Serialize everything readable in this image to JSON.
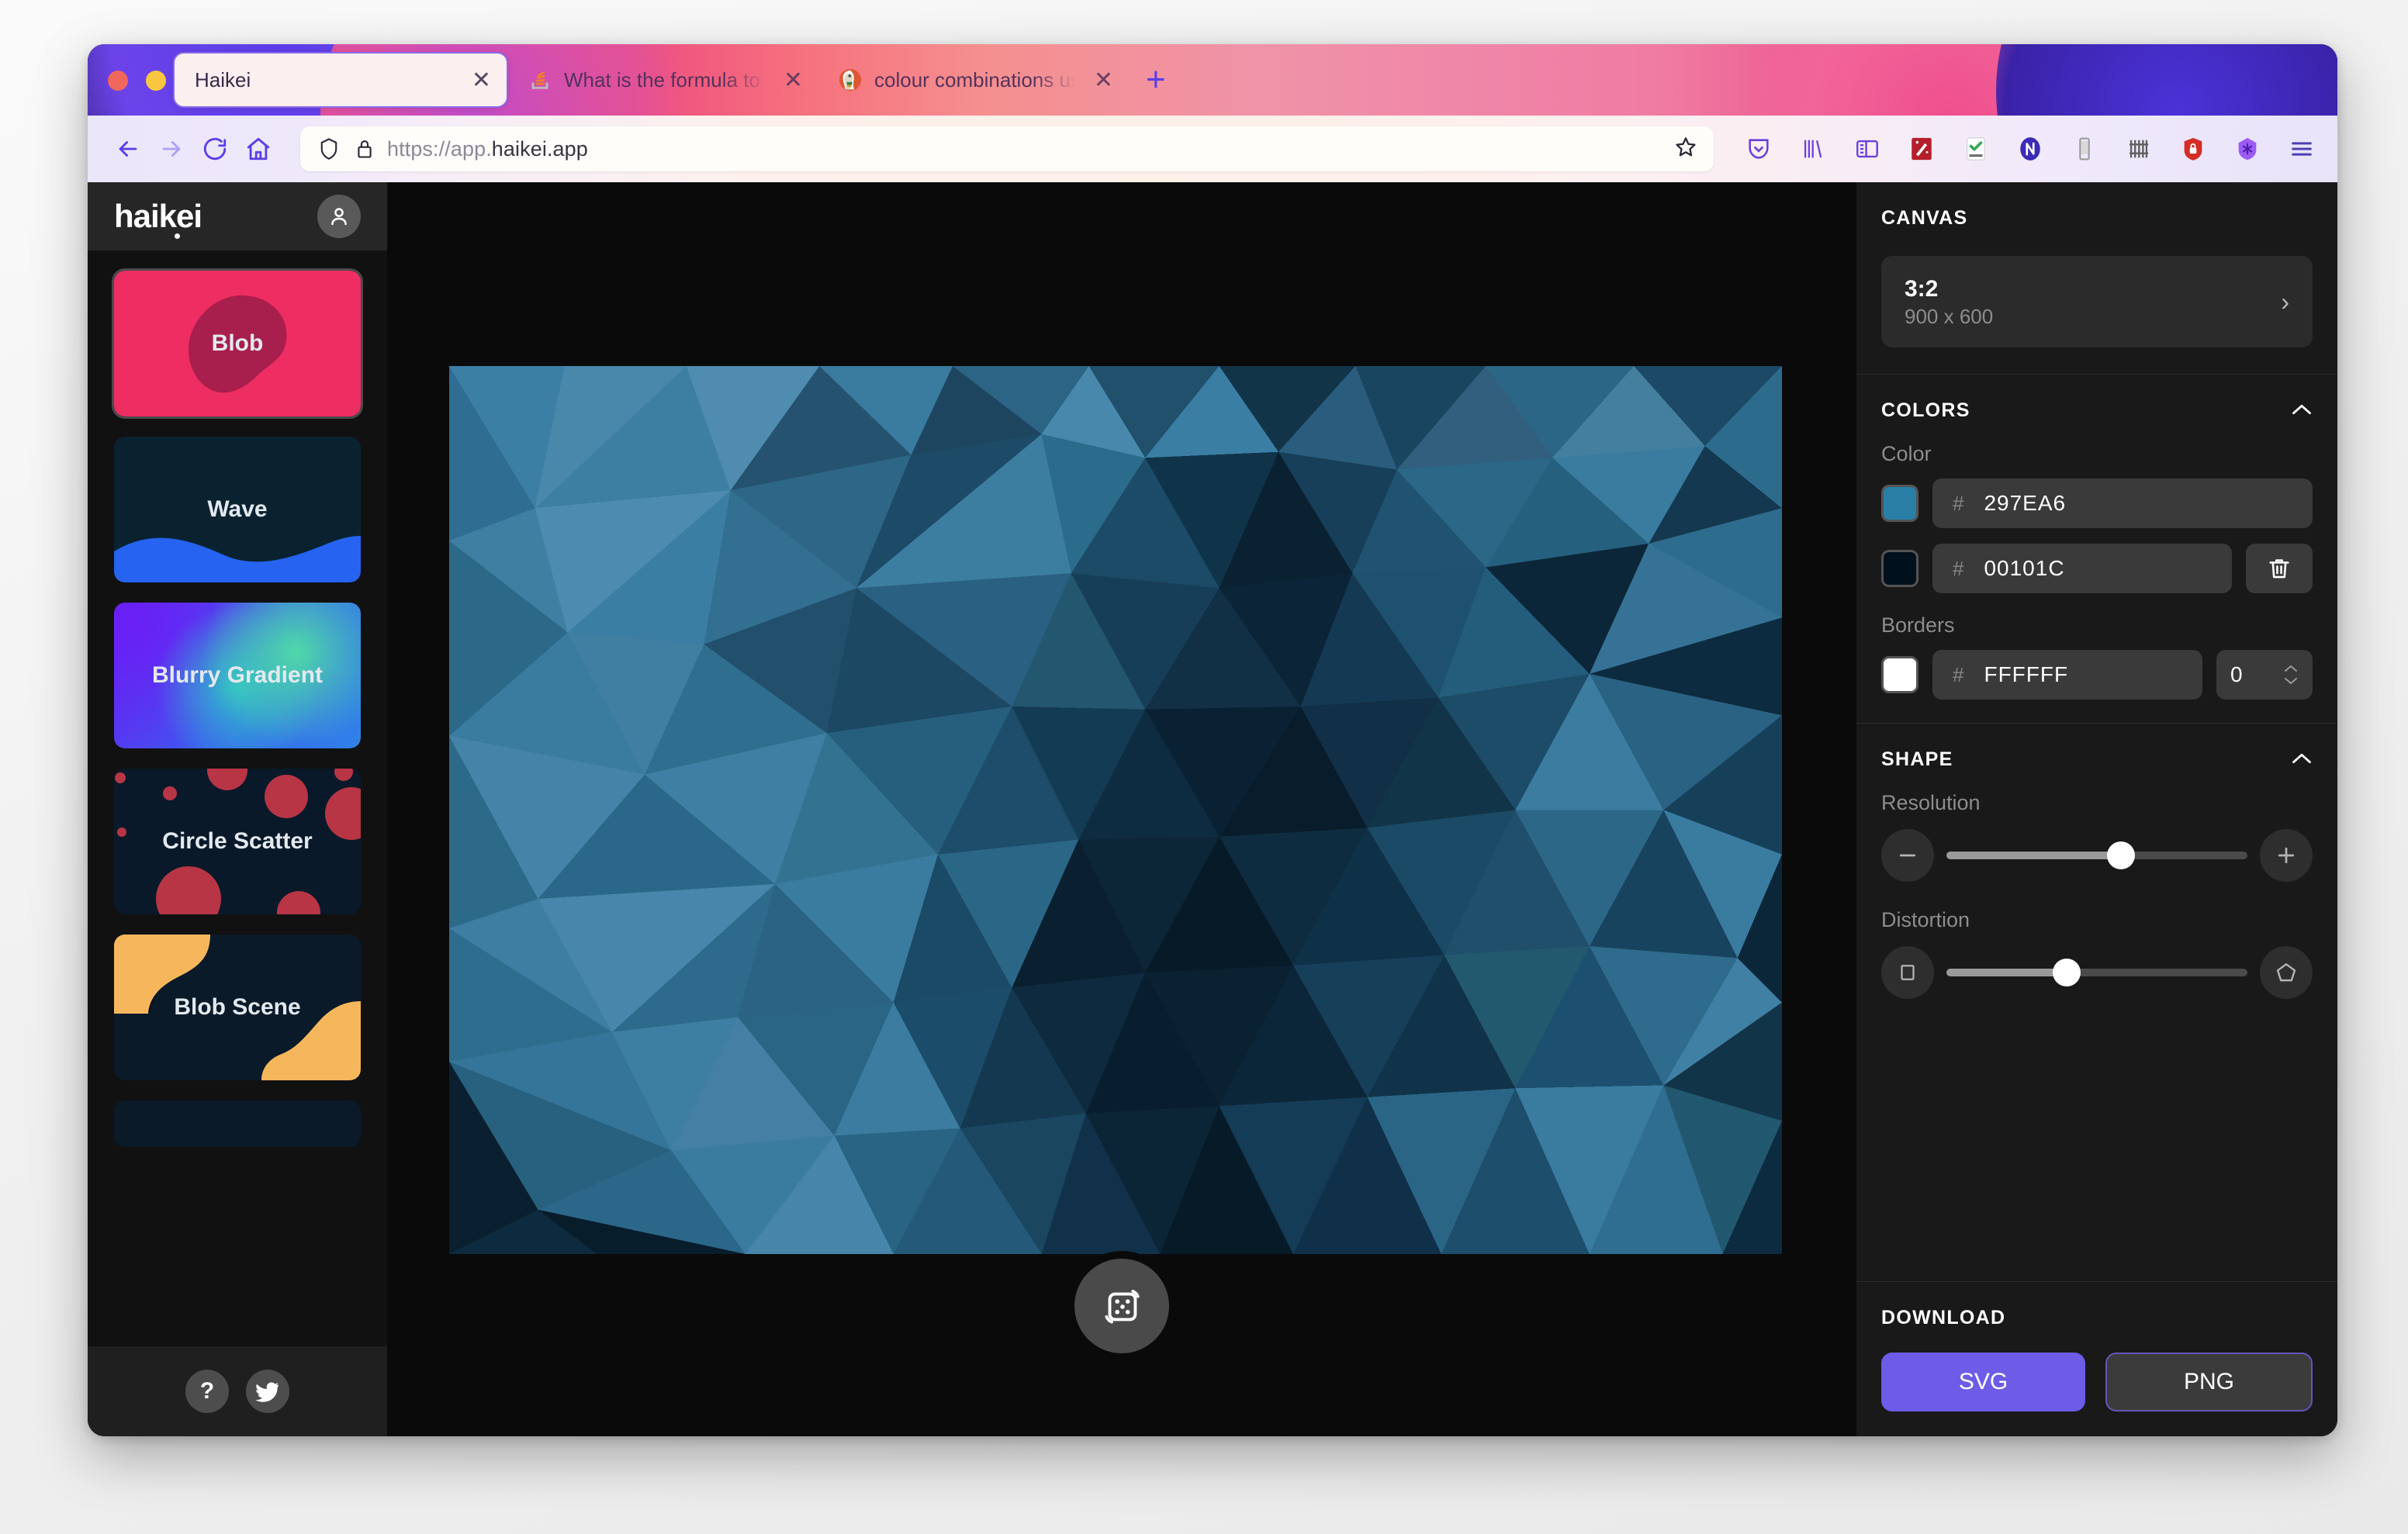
{
  "browser": {
    "tabs": [
      {
        "title": "Haikei",
        "favicon": "none",
        "active": true,
        "close": "✕"
      },
      {
        "title": "What is the formula to generate",
        "favicon": "stackoverflow-icon",
        "active": false,
        "close": "✕"
      },
      {
        "title": "colour combinations using two c",
        "favicon": "duckduckgo-icon",
        "active": false,
        "close": "✕"
      }
    ],
    "new_tab_label": "+",
    "nav": {
      "back": "back-icon",
      "forward": "forward-icon",
      "reload": "reload-icon",
      "home": "home-icon"
    },
    "url": {
      "protocol": "https://app.",
      "domain": "haikei.app",
      "full": "https://app.haikei.app",
      "shield_icon": "shield-icon",
      "lock_icon": "lock-icon",
      "bookmark_icon": "star-icon"
    },
    "extensions": [
      "pocket-icon",
      "library-icon",
      "sidebar-icon",
      "wand-icon",
      "todoist-icon",
      "notion-icon",
      "responsive-icon",
      "barcode-icon",
      "lastpass-icon",
      "bitwarden-icon",
      "menu-icon"
    ]
  },
  "sidebar": {
    "logo": "haikei",
    "avatar": "user-avatar-icon",
    "presets": [
      {
        "name": "Blob",
        "selected": true
      },
      {
        "name": "Wave",
        "selected": false
      },
      {
        "name": "Blurry Gradient",
        "selected": false
      },
      {
        "name": "Circle Scatter",
        "selected": false
      },
      {
        "name": "Blob Scene",
        "selected": false
      },
      {
        "name": "",
        "selected": false
      }
    ],
    "footer": {
      "help_label": "?",
      "help_icon": "question-mark-icon",
      "twitter_icon": "twitter-icon"
    }
  },
  "stage": {
    "randomize_icon": "dice-shuffle-icon"
  },
  "panel": {
    "canvas": {
      "heading": "CANVAS",
      "ratio": "3:2",
      "dimensions": "900 x 600",
      "caret": "›"
    },
    "colors": {
      "heading": "COLORS",
      "collapse_icon": "chevron-up-icon",
      "color_label": "Color",
      "hash": "#",
      "items": [
        {
          "hex": "297EA6",
          "swatch": "#297EA6",
          "deletable": false
        },
        {
          "hex": "00101C",
          "swatch": "#00101C",
          "deletable": true,
          "delete_icon": "trash-icon"
        }
      ],
      "borders_label": "Borders",
      "border": {
        "hex": "FFFFFF",
        "swatch": "#FFFFFF",
        "width": "0"
      }
    },
    "shape": {
      "heading": "SHAPE",
      "collapse_icon": "chevron-up-icon",
      "resolution": {
        "label": "Resolution",
        "minus": "−",
        "plus": "+",
        "percent": 58
      },
      "distortion": {
        "label": "Distortion",
        "min_icon": "square-icon",
        "max_icon": "pentagon-icon",
        "percent": 40
      }
    },
    "download": {
      "heading": "DOWNLOAD",
      "svg_label": "SVG",
      "png_label": "PNG"
    }
  },
  "artwork": {
    "type": "low-poly-triangle-mesh",
    "color_light": "#297EA6",
    "color_dark": "#00101C",
    "background": "#0a0a0a"
  }
}
